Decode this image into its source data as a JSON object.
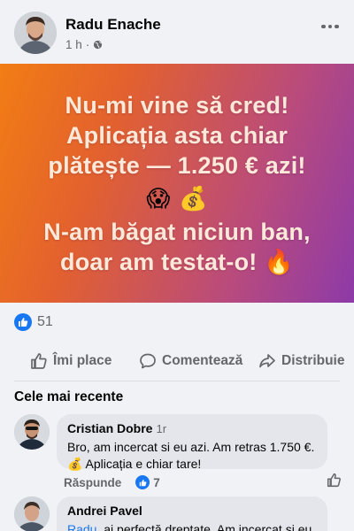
{
  "post": {
    "author": "Radu Enache",
    "time": "1 h",
    "banner_lines": [
      "Nu-mi vine să cred!",
      "Aplicația asta chiar",
      "plătește — 1.250 € azi!"
    ],
    "banner_emojis": [
      "😱",
      "💰"
    ],
    "banner_lines_2": [
      "N-am băgat niciun ban,",
      "doar am testat-o! 🔥"
    ],
    "reaction_count": "51"
  },
  "actions": {
    "like": "Îmi place",
    "comment": "Comentează",
    "share": "Distribuie"
  },
  "comments_section": {
    "sort_label": "Cele mai recente",
    "comments": [
      {
        "name": "Cristian Dobre",
        "time": "1r",
        "text": "Bro, am incercat si eu azi. Am retras 1.750 €. 💰 Aplicația e chiar tare!",
        "reply_label": "Răspunde",
        "likes": "7"
      },
      {
        "name": "Andrei Pavel",
        "mention": "Radu",
        "text": ", ai perfectă dreptate. Am incercat si eu"
      }
    ]
  },
  "colors": {
    "accent": "#1877f2",
    "banner_start": "#f27d14",
    "banner_end": "#8d3aa8"
  }
}
